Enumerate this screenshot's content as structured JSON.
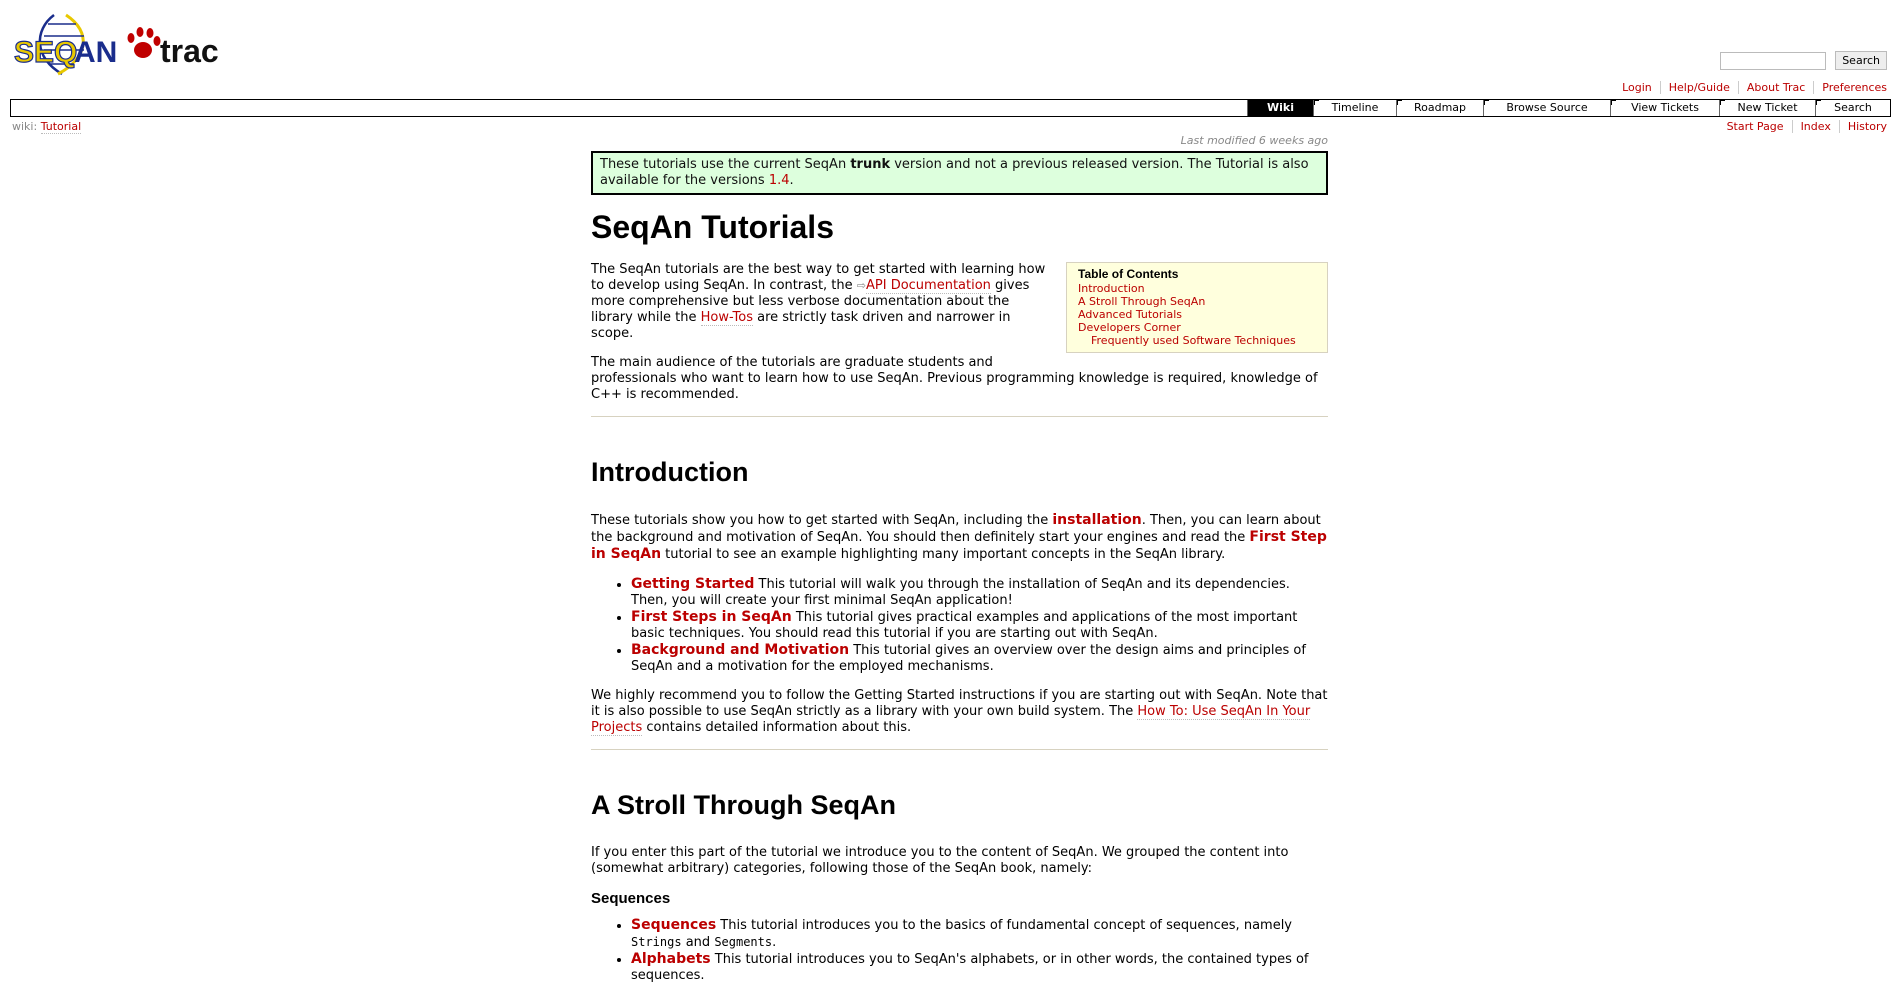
{
  "header": {
    "logo": {
      "left_text": "SEQAN",
      "right_text": "trac",
      "colors": {
        "yellow": "#e8c800",
        "blue": "#1a2d8c",
        "red": "#c00000"
      }
    },
    "search": {
      "placeholder": "",
      "button_label": "Search"
    },
    "metanav": [
      "Login",
      "Help/Guide",
      "About Trac",
      "Preferences"
    ]
  },
  "mainnav": {
    "tabs": [
      "Wiki",
      "Timeline",
      "Roadmap",
      "Browse Source",
      "View Tickets",
      "New Ticket",
      "Search"
    ],
    "active": "Wiki"
  },
  "ctxbar": {
    "crumb_prefix": "wiki:",
    "crumb_page": "Tutorial",
    "links": [
      "Start Page",
      "Index",
      "History"
    ]
  },
  "page": {
    "last_modified": "Last modified 6 weeks ago",
    "notice": {
      "pre": "These tutorials use the current SeqAn ",
      "bold": "trunk",
      "mid": " version and not a previous released version. The Tutorial is also available for the versions ",
      "link": "1.4",
      "post": "."
    },
    "title": "SeqAn Tutorials",
    "toc": {
      "title": "Table of Contents",
      "items": [
        "Introduction",
        "A Stroll Through SeqAn",
        "Advanced Tutorials",
        "Developers Corner"
      ],
      "subitem": "Frequently used Software Techniques"
    },
    "intro_p1": {
      "a": "The SeqAn tutorials are the best way to get started with learning how to develop using SeqAn. In contrast, the ",
      "link1": "API Documentation",
      "b": " gives more comprehensive but less verbose documentation about the library while the ",
      "link2": "How-Tos",
      "c": " are strictly task driven and narrower in scope."
    },
    "intro_p2": "The main audience of the tutorials are graduate students and professionals who want to learn how to use SeqAn. Previous programming knowledge is required, knowledge of C++ is recommended.",
    "introduction": {
      "heading": "Introduction",
      "p1_a": "These tutorials show you how to get started with SeqAn, including the ",
      "p1_link1": "installation",
      "p1_b": ". Then, you can learn about the background and motivation of SeqAn. You should then definitely start your engines and read the ",
      "p1_link2": "First Step in SeqAn",
      "p1_c": " tutorial to see an example highlighting many important concepts in the SeqAn library.",
      "items": [
        {
          "link": "Getting Started",
          "text": " This tutorial will walk you through the installation of SeqAn and its dependencies. Then, you will create your first minimal SeqAn application!"
        },
        {
          "link": "First Steps in SeqAn",
          "text": " This tutorial gives practical examples and applications of the most important basic techniques. You should read this tutorial if you are starting out with SeqAn."
        },
        {
          "link": "Background and Motivation",
          "text": " This tutorial gives an overview over the design aims and principles of SeqAn and a motivation for the employed mechanisms."
        }
      ],
      "p2_a": "We highly recommend you to follow the Getting Started instructions if you are starting out with SeqAn. Note that it is also possible to use SeqAn strictly as a library with your own build system. The ",
      "p2_link": "How To: Use SeqAn In Your Projects",
      "p2_b": " contains detailed information about this."
    },
    "stroll": {
      "heading": "A Stroll Through SeqAn",
      "p1": "If you enter this part of the tutorial we introduce you to the content of SeqAn. We grouped the content into (somewhat arbitrary) categories, following those of the SeqAn book, namely:",
      "subheading": "Sequences",
      "item_link": "Sequences",
      "item_a": " This tutorial introduces you to the basics of fundamental concept of sequences, namely ",
      "code1": "Strings",
      "item_b": " and ",
      "code2": "Segments",
      "item_c": ".",
      "item2_link": "Alphabets",
      "item2_text": " This tutorial introduces you to SeqAn's alphabets, or in other words, the contained types of sequences."
    }
  }
}
